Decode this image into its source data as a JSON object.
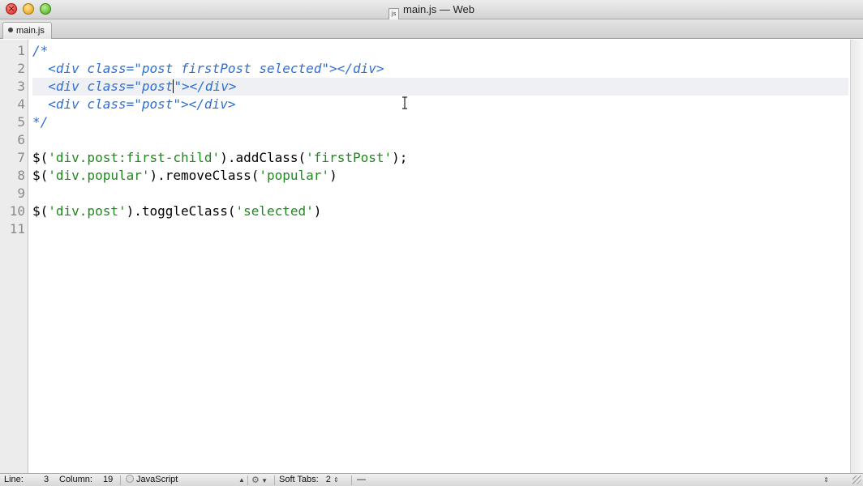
{
  "window": {
    "title": "main.js — Web",
    "file_icon": "js"
  },
  "tabs": [
    {
      "label": "main.js"
    }
  ],
  "editor": {
    "cursor_line": 3,
    "line_numbers": [
      "1",
      "2",
      "3",
      "4",
      "5",
      "6",
      "7",
      "8",
      "9",
      "10",
      "11"
    ],
    "lines": [
      {
        "segments": [
          {
            "t": "/*",
            "c": "cm"
          }
        ]
      },
      {
        "segments": [
          {
            "t": "  <div class=\"post firstPost selected\"></div>",
            "c": "cm"
          }
        ]
      },
      {
        "segments": [
          {
            "t": "  <div class=\"post",
            "c": "cm"
          },
          {
            "t": "|",
            "c": "caret"
          },
          {
            "t": "\"></div>",
            "c": "cm"
          }
        ]
      },
      {
        "segments": [
          {
            "t": "  <div class=\"post\"></div>",
            "c": "cm"
          }
        ]
      },
      {
        "segments": [
          {
            "t": "*/",
            "c": "cm"
          }
        ]
      },
      {
        "segments": []
      },
      {
        "segments": [
          {
            "t": "$(",
            "c": ""
          },
          {
            "t": "'div.post:first-child'",
            "c": "str"
          },
          {
            "t": ").addClass(",
            "c": ""
          },
          {
            "t": "'firstPost'",
            "c": "str"
          },
          {
            "t": ");",
            "c": ""
          }
        ]
      },
      {
        "segments": [
          {
            "t": "$(",
            "c": ""
          },
          {
            "t": "'div.popular'",
            "c": "str"
          },
          {
            "t": ").removeClass(",
            "c": ""
          },
          {
            "t": "'popular'",
            "c": "str"
          },
          {
            "t": ")",
            "c": ""
          }
        ]
      },
      {
        "segments": []
      },
      {
        "segments": [
          {
            "t": "$(",
            "c": ""
          },
          {
            "t": "'div.post'",
            "c": "str"
          },
          {
            "t": ").toggleClass(",
            "c": ""
          },
          {
            "t": "'selected'",
            "c": "str"
          },
          {
            "t": ")",
            "c": ""
          }
        ]
      },
      {
        "segments": []
      }
    ]
  },
  "statusbar": {
    "line_label": "Line:",
    "line_value": "3",
    "column_label": "Column:",
    "column_value": "19",
    "language": "JavaScript",
    "soft_tabs_label": "Soft Tabs:",
    "soft_tabs_value": "2",
    "symbol": "—",
    "gear_icon": "gear-icon"
  },
  "colors": {
    "comment": "#2f6fd1",
    "string": "#1e8a1e",
    "current_line": "#eef0f3"
  }
}
